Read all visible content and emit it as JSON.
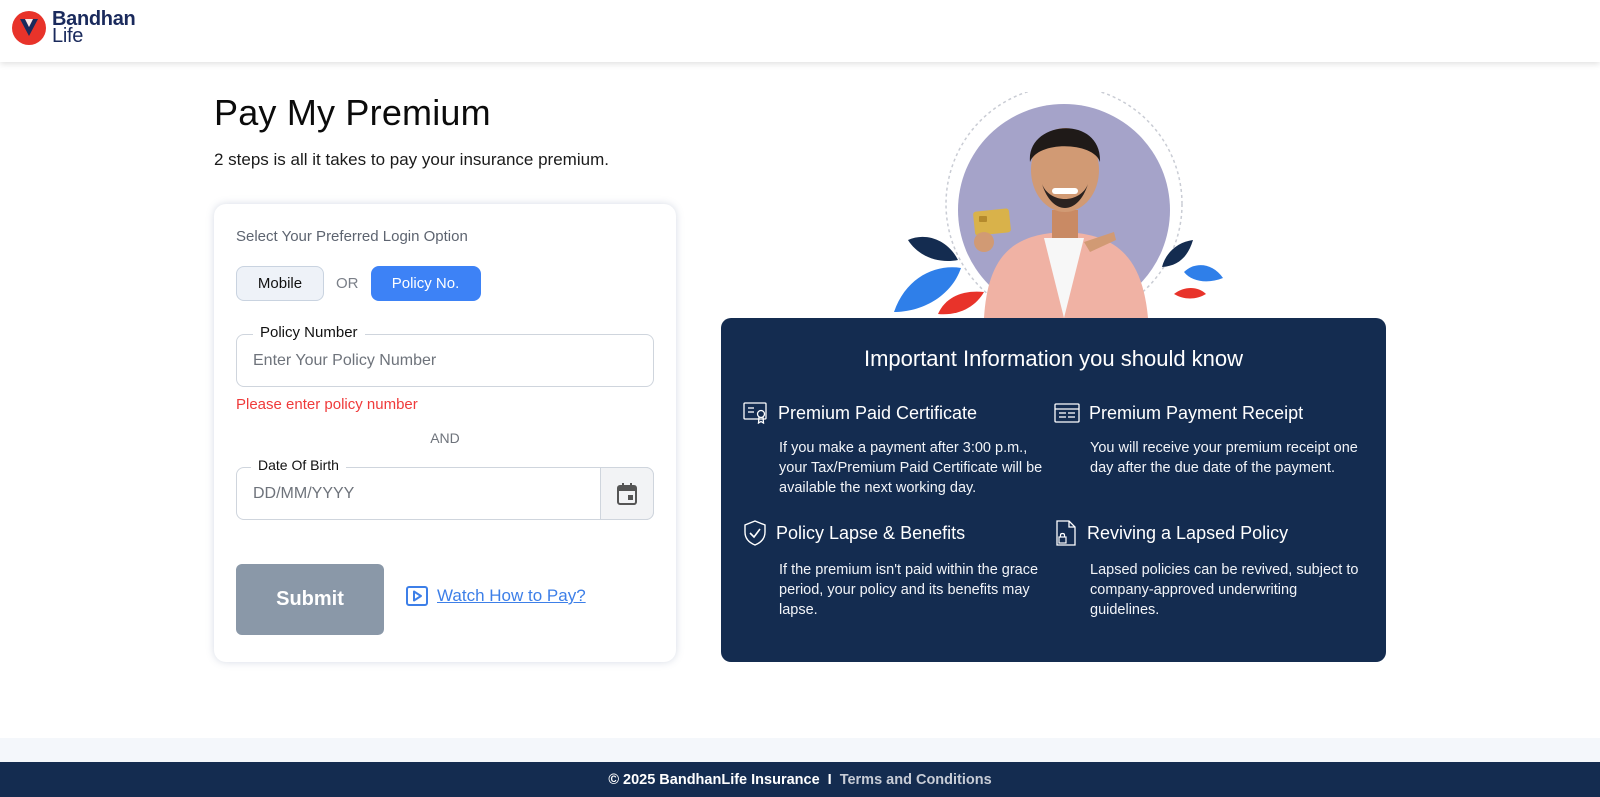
{
  "header": {
    "logo_line1": "Bandhan",
    "logo_line2": "Life"
  },
  "page": {
    "title": "Pay My Premium",
    "subtitle": "2 steps is all it takes to pay your insurance premium."
  },
  "form": {
    "login_option_label": "Select Your Preferred Login Option",
    "mobile_label": "Mobile",
    "or_label": "OR",
    "policy_label": "Policy No.",
    "policy_field_label": "Policy Number",
    "policy_placeholder": "Enter Your Policy Number",
    "policy_error": "Please enter policy number",
    "and_label": "AND",
    "dob_field_label": "Date Of Birth",
    "dob_placeholder": "DD/MM/YYYY",
    "submit_label": "Submit",
    "watch_label": "Watch How to Pay?"
  },
  "info": {
    "title": "Important Information you should know",
    "items": [
      {
        "icon": "certificate-icon",
        "title": "Premium Paid Certificate",
        "body": "If you make a payment after 3:00 p.m., your Tax/Premium Paid Certificate will be available the next working day."
      },
      {
        "icon": "receipt-icon",
        "title": "Premium Payment Receipt",
        "body": "You will receive your premium receipt one day after the due date of the payment."
      },
      {
        "icon": "shield-check-icon",
        "title": "Policy Lapse & Benefits",
        "body": "If the premium isn't paid within the grace period, your policy and its benefits may lapse."
      },
      {
        "icon": "document-lock-icon",
        "title": "Reviving a Lapsed Policy",
        "body": "Lapsed policies can be revived, subject to company-approved underwriting guidelines."
      }
    ]
  },
  "footer": {
    "copyright": "© 2025 BandhanLife Insurance",
    "separator": "I",
    "terms": "Terms and Conditions"
  },
  "colors": {
    "primary_blue": "#3d82f6",
    "navy": "#142c50",
    "error_red": "#ef3b3b",
    "submit_disabled": "#8a98a8",
    "brand_red": "#e8332a"
  }
}
